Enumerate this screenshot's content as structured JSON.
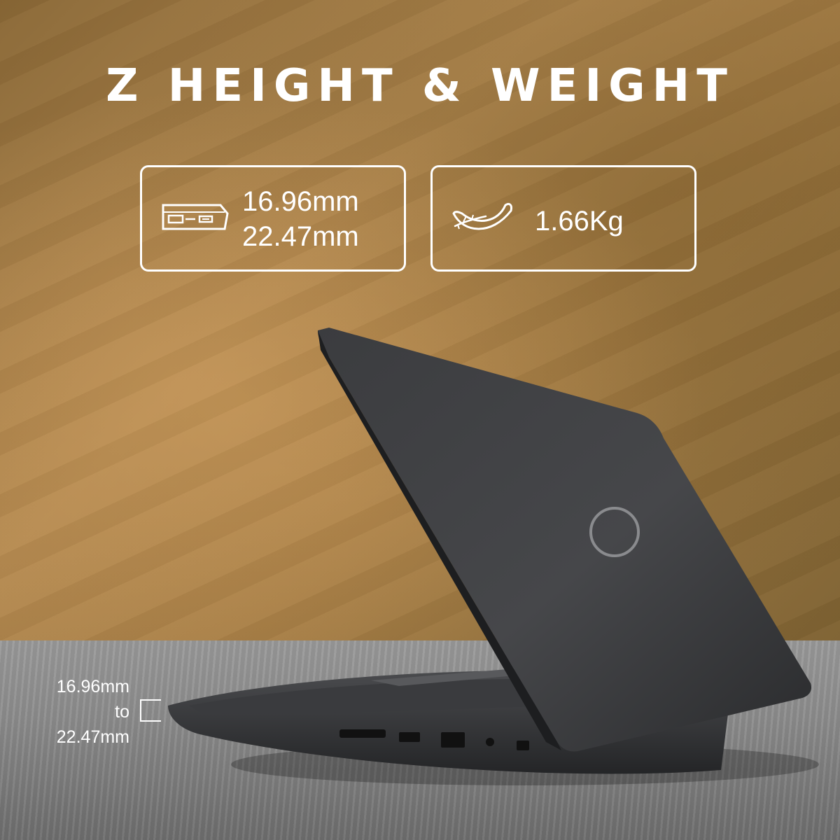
{
  "heading": "Z HEIGHT & WEIGHT",
  "height_card": {
    "icon": "laptop-profile-icon",
    "line1": "16.96mm",
    "line2": "22.47mm"
  },
  "weight_card": {
    "icon": "feather-icon",
    "value": "1.66Kg"
  },
  "side_dimension": {
    "from": "16.96mm",
    "connector": "to",
    "to": "22.47mm"
  },
  "colors": {
    "wall": "#a37b43",
    "table": "#8c8c8c",
    "laptop": "#2f3032",
    "text": "#ffffff"
  }
}
